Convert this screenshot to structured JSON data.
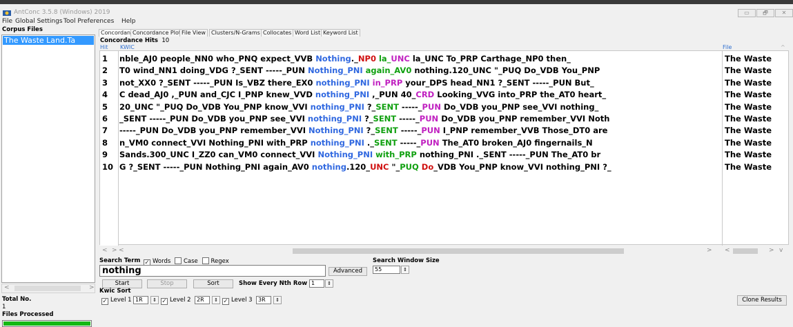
{
  "window": {
    "title": "AntConc 3.5.8 (Windows) 2019",
    "controls": [
      "▭",
      "🗗",
      "✕"
    ]
  },
  "menu": [
    "File",
    "Global Settings",
    "Tool Preferences",
    "Help"
  ],
  "left_panel": {
    "corpus_files_label": "Corpus Files",
    "files": [
      "The Waste Land.Ta"
    ],
    "total_no_label": "Total No.",
    "total_no_value": "1",
    "files_processed_label": "Files Processed",
    "progress_fraction": 1.0
  },
  "tabs": [
    "Concordance",
    "Concordance Plot",
    "File View",
    "Clusters/N-Grams",
    "Collocates",
    "Word List",
    "Keyword List"
  ],
  "active_tab": "Concordance",
  "concordance": {
    "hits_label": "Concordance Hits",
    "hits_count": "10",
    "col_hit": "Hit",
    "col_kwic": "KWIC",
    "col_file": "File",
    "rows": [
      {
        "hit": "1",
        "file": "The Waste",
        "segments": [
          {
            "t": "nble_AJ0 people_NN0 who_PNQ expect_VVB ",
            "c": ""
          },
          {
            "t": "Nothing",
            "c": "kw"
          },
          {
            "t": "._",
            "c": ""
          },
          {
            "t": "NP0 ",
            "c": "c1"
          },
          {
            "t": "la_",
            "c": "c2"
          },
          {
            "t": "UNC",
            "c": "c3"
          },
          {
            "t": "  la_UNC To_PRP Carthage_NP0 then_",
            "c": ""
          }
        ]
      },
      {
        "hit": "2",
        "file": "The Waste",
        "segments": [
          {
            "t": "T0 wind_NN1 doing_VDG ?_SENT -----_PUN  ",
            "c": ""
          },
          {
            "t": "Nothing_PNI ",
            "c": "kw"
          },
          {
            "t": "again_AV0",
            "c": "c2"
          },
          {
            "t": " nothing.120_UNC \"_PUQ Do_VDB You_PNP",
            "c": ""
          }
        ]
      },
      {
        "hit": "3",
        "file": "The Waste",
        "segments": [
          {
            "t": "not_XX0 ?_SENT -----_PUN  Is_VBZ there_EX0 ",
            "c": ""
          },
          {
            "t": "nothing_PNI ",
            "c": "kw"
          },
          {
            "t": "in_PRP",
            "c": "c3"
          },
          {
            "t": " your_DPS head_NN1 ?_SENT -----_PUN  But_",
            "c": ""
          }
        ]
      },
      {
        "hit": "4",
        "file": "The Waste",
        "segments": [
          {
            "t": "C dead_AJ0 ,_PUN and_CJC I_PNP knew_VVD ",
            "c": ""
          },
          {
            "t": "nothing_PNI",
            "c": "kw"
          },
          {
            "t": " ,_PUN 40_",
            "c": ""
          },
          {
            "t": "CRD",
            "c": "c3"
          },
          {
            "t": "  Looking_VVG into_PRP the_AT0 heart_",
            "c": ""
          }
        ]
      },
      {
        "hit": "5",
        "file": "The Waste",
        "segments": [
          {
            "t": "20_UNC \"_PUQ Do_VDB You_PNP know_VVI  ",
            "c": ""
          },
          {
            "t": "nothing_PNI",
            "c": "kw"
          },
          {
            "t": " ?_",
            "c": ""
          },
          {
            "t": "SENT",
            "c": "c2"
          },
          {
            "t": " -----_",
            "c": ""
          },
          {
            "t": "PUN",
            "c": "c3"
          },
          {
            "t": "  Do_VDB you_PNP see_VVI nothing_",
            "c": ""
          }
        ]
      },
      {
        "hit": "6",
        "file": "The Waste",
        "segments": [
          {
            "t": "_SENT -----_PUN  Do_VDB you_PNP see_VVI ",
            "c": ""
          },
          {
            "t": "nothing_PNI",
            "c": "kw"
          },
          {
            "t": " ?_",
            "c": ""
          },
          {
            "t": "SENT",
            "c": "c2"
          },
          {
            "t": " -----_",
            "c": ""
          },
          {
            "t": "PUN",
            "c": "c3"
          },
          {
            "t": "  Do_VDB you_PNP remember_VVI Noth",
            "c": ""
          }
        ]
      },
      {
        "hit": "7",
        "file": "The Waste",
        "segments": [
          {
            "t": "-----_PUN  Do_VDB you_PNP remember_VVI ",
            "c": ""
          },
          {
            "t": "Nothing_PNI",
            "c": "kw"
          },
          {
            "t": " ?_",
            "c": ""
          },
          {
            "t": "SENT",
            "c": "c2"
          },
          {
            "t": " -----_",
            "c": ""
          },
          {
            "t": "PUN",
            "c": "c3"
          },
          {
            "t": "  I_PNP remember_VVB Those_DT0 are",
            "c": ""
          }
        ]
      },
      {
        "hit": "8",
        "file": "The Waste",
        "segments": [
          {
            "t": "n_VM0 connect_VVI Nothing_PNI  with_PRP ",
            "c": ""
          },
          {
            "t": "nothing_PNI",
            "c": "kw"
          },
          {
            "t": " ._",
            "c": ""
          },
          {
            "t": "SENT",
            "c": "c2"
          },
          {
            "t": " -----_",
            "c": ""
          },
          {
            "t": "PUN",
            "c": "c3"
          },
          {
            "t": "  The_AT0 broken_AJ0 fingernails_N",
            "c": ""
          }
        ]
      },
      {
        "hit": "9",
        "file": "The Waste",
        "segments": [
          {
            "t": "Sands.300_UNC I_ZZ0 can_VM0 connect_VVI ",
            "c": ""
          },
          {
            "t": "Nothing_PNI ",
            "c": "kw"
          },
          {
            "t": " with_PRP",
            "c": "c2"
          },
          {
            "t": " nothing_PNI ._SENT -----_PUN  The_AT0 br",
            "c": ""
          }
        ]
      },
      {
        "hit": "10",
        "file": "The Waste",
        "segments": [
          {
            "t": "G ?_SENT -----_PUN  Nothing_PNI again_AV0 ",
            "c": ""
          },
          {
            "t": "nothing",
            "c": "kw"
          },
          {
            "t": ".120_",
            "c": ""
          },
          {
            "t": "UNC",
            "c": "c1"
          },
          {
            "t": " \"_",
            "c": ""
          },
          {
            "t": "PUQ",
            "c": "c2"
          },
          {
            "t": " Do",
            "c": "c1"
          },
          {
            "t": "_VDB You_PNP know_VVI  nothing_PNI ?_",
            "c": ""
          }
        ]
      }
    ]
  },
  "search": {
    "term_label": "Search Term",
    "opt_words": "Words",
    "opt_case": "Case",
    "opt_regex": "Regex",
    "words_checked": true,
    "case_checked": false,
    "regex_checked": false,
    "value": "nothing",
    "advanced_label": "Advanced",
    "window_size_label": "Search Window Size",
    "window_size_value": "55",
    "start_label": "Start",
    "stop_label": "Stop",
    "sort_label": "Sort",
    "nth_row_label": "Show Every Nth Row",
    "nth_row_value": "1",
    "kwic_sort_label": "Kwic Sort",
    "level1_label": "Level 1",
    "level1_value": "1R",
    "level2_label": "Level 2",
    "level2_value": "2R",
    "level3_label": "Level 3",
    "level3_value": "3R",
    "clone_label": "Clone Results"
  }
}
